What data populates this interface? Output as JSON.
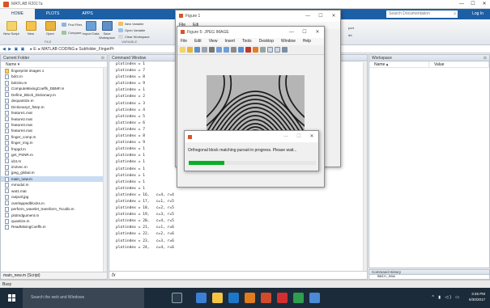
{
  "window": {
    "title": "MATLAB R2017a",
    "min": "—",
    "max": "☐",
    "close": "✕"
  },
  "ribbon": {
    "tabs": [
      "HOME",
      "PLOTS",
      "APPS"
    ],
    "search_placeholder": "Search Documentation",
    "login": "Log In",
    "buttons": {
      "new_script": "New Script",
      "new": "New",
      "open": "Open",
      "find_files": "Find Files",
      "compare": "Compare",
      "import_data": "Import Data",
      "save_workspace": "Save Workspace",
      "new_variable": "New Variable",
      "open_variable": "Open Variable",
      "clear_workspace": "Clear Workspace"
    },
    "sections": {
      "file": "FILE",
      "variable": "VARIABLE"
    },
    "truncated_right": [
      "port",
      "dd"
    ]
  },
  "addressbar": {
    "nav": "◀ ▶ ▣ ▣",
    "path": "▸ E: ▸ MATLAB CODING ▸ Subfolder_FingerPr"
  },
  "current_folder": {
    "title": "Current Folder",
    "column": "Name ▾",
    "files": [
      {
        "name": "fingerprint images 1",
        "type": "folder"
      },
      {
        "name": "bdct.m",
        "type": "m"
      },
      {
        "name": "bdctinv.m",
        "type": "m"
      },
      {
        "name": "ComputeMixingCoeffs_DBMF.m",
        "type": "m"
      },
      {
        "name": "Define_Block_Dictionary.m",
        "type": "m"
      },
      {
        "name": "dequantize.m",
        "type": "m"
      },
      {
        "name": "Dictionary2_fstep.m",
        "type": "m"
      },
      {
        "name": "feature1.mat",
        "type": "mat"
      },
      {
        "name": "feature2.mat",
        "type": "mat"
      },
      {
        "name": "feature3.mat",
        "type": "mat"
      },
      {
        "name": "feature4.mat",
        "type": "mat"
      },
      {
        "name": "finger_comp.m",
        "type": "m"
      },
      {
        "name": "finger_img.m",
        "type": "m"
      },
      {
        "name": "fmpgd.m",
        "type": "m"
      },
      {
        "name": "get_PSNR.m",
        "type": "m"
      },
      {
        "name": "idct.m",
        "type": "m"
      },
      {
        "name": "im2vec.m",
        "type": "m"
      },
      {
        "name": "jpeg_global.m",
        "type": "m"
      },
      {
        "name": "main_new.m",
        "type": "m",
        "selected": true
      },
      {
        "name": "mmodul.m",
        "type": "m"
      },
      {
        "name": "wat1.mat",
        "type": "mat"
      },
      {
        "name": "outputl.jpg",
        "type": "jpg"
      },
      {
        "name": "overlappedblocks.m",
        "type": "m"
      },
      {
        "name": "perform_wavelet_transform_Tccallo.m",
        "type": "m"
      },
      {
        "name": "plotmdgument.m",
        "type": "m"
      },
      {
        "name": "quantize.m",
        "type": "m"
      },
      {
        "name": "ReadMixingCoeffs.m",
        "type": "m"
      }
    ],
    "footer": "main_new.m (Script)"
  },
  "command_window": {
    "title": "Command Window",
    "lines": [
      "plotindex = 1",
      "plotindex = 7",
      "plotindex = 8",
      "plotindex = 9",
      "plotindex = 1",
      "plotindex = 2",
      "plotindex = 3",
      "plotindex = 4",
      "plotindex = 5",
      "plotindex = 6",
      "plotindex = 7",
      "plotindex = 8",
      "plotindex = 9",
      "plotindex = 1",
      "plotindex = 1",
      "plotindex = 1",
      "plotindex = 1",
      "plotindex = 1",
      "plotindex = 1",
      "plotindex = 1",
      "plotindex = 16,   c=4, r=4",
      "plotindex = 17,   c=1, r=5",
      "plotindex = 18,   c=2, r=5",
      "plotindex = 19,   c=3, r=5",
      "plotindex = 20,   c=4, r=5",
      "plotindex = 21,   c=1, r=6",
      "plotindex = 22,   c=2, r=6",
      "plotindex = 23,   c=3, r=6",
      "plotindex = 24,   c=4, r=6"
    ],
    "prompt": "fx"
  },
  "workspace": {
    "title": "Workspace",
    "columns": [
      "Name ▴",
      "Value"
    ]
  },
  "command_history": {
    "title": "Command History",
    "item": "main_new"
  },
  "status": "Busy",
  "figure_back": {
    "title": "Figure 1",
    "menu": [
      "File",
      "Edi"
    ]
  },
  "figure_main": {
    "title": "Figure 5: JPEG IMAGE",
    "menu": [
      "File",
      "Edit",
      "View",
      "Insert",
      "Tools",
      "Desktop",
      "Window",
      "Help"
    ]
  },
  "progress_dialog": {
    "message": "Orthogonal block matching pursuit in progress. Please wait...",
    "progress": 0.28,
    "fill_color": "#06b025"
  },
  "taskbar": {
    "search": "Search the web and Windows",
    "time": "3:45 PM",
    "date": "6/30/2017",
    "tray": "^ ▮ ◁) ▭"
  }
}
